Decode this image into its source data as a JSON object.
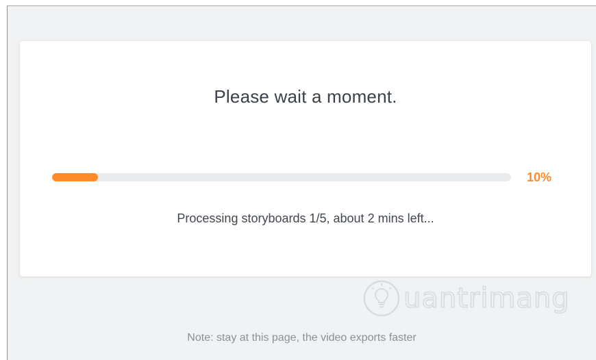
{
  "dialog": {
    "title": "Please wait a moment.",
    "progress": {
      "percent_value": 10,
      "percent_label": "10%",
      "color": "#ff8a2b",
      "track_color": "#e9ebed"
    },
    "status_text": "Processing storyboards 1/5, about 2 mins left..."
  },
  "watermark": {
    "text": "uantrimang",
    "icon": "lightbulb-icon"
  },
  "footer": {
    "note": "Note: stay at this page, the video exports faster"
  }
}
